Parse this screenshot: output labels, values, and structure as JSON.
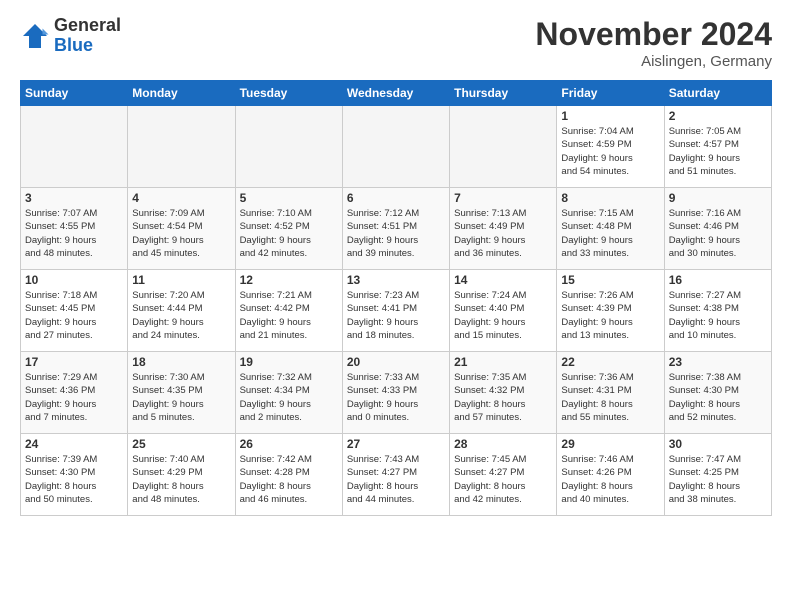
{
  "logo": {
    "general": "General",
    "blue": "Blue"
  },
  "title": "November 2024",
  "location": "Aislingen, Germany",
  "days_of_week": [
    "Sunday",
    "Monday",
    "Tuesday",
    "Wednesday",
    "Thursday",
    "Friday",
    "Saturday"
  ],
  "weeks": [
    [
      {
        "day": "",
        "info": ""
      },
      {
        "day": "",
        "info": ""
      },
      {
        "day": "",
        "info": ""
      },
      {
        "day": "",
        "info": ""
      },
      {
        "day": "",
        "info": ""
      },
      {
        "day": "1",
        "info": "Sunrise: 7:04 AM\nSunset: 4:59 PM\nDaylight: 9 hours\nand 54 minutes."
      },
      {
        "day": "2",
        "info": "Sunrise: 7:05 AM\nSunset: 4:57 PM\nDaylight: 9 hours\nand 51 minutes."
      }
    ],
    [
      {
        "day": "3",
        "info": "Sunrise: 7:07 AM\nSunset: 4:55 PM\nDaylight: 9 hours\nand 48 minutes."
      },
      {
        "day": "4",
        "info": "Sunrise: 7:09 AM\nSunset: 4:54 PM\nDaylight: 9 hours\nand 45 minutes."
      },
      {
        "day": "5",
        "info": "Sunrise: 7:10 AM\nSunset: 4:52 PM\nDaylight: 9 hours\nand 42 minutes."
      },
      {
        "day": "6",
        "info": "Sunrise: 7:12 AM\nSunset: 4:51 PM\nDaylight: 9 hours\nand 39 minutes."
      },
      {
        "day": "7",
        "info": "Sunrise: 7:13 AM\nSunset: 4:49 PM\nDaylight: 9 hours\nand 36 minutes."
      },
      {
        "day": "8",
        "info": "Sunrise: 7:15 AM\nSunset: 4:48 PM\nDaylight: 9 hours\nand 33 minutes."
      },
      {
        "day": "9",
        "info": "Sunrise: 7:16 AM\nSunset: 4:46 PM\nDaylight: 9 hours\nand 30 minutes."
      }
    ],
    [
      {
        "day": "10",
        "info": "Sunrise: 7:18 AM\nSunset: 4:45 PM\nDaylight: 9 hours\nand 27 minutes."
      },
      {
        "day": "11",
        "info": "Sunrise: 7:20 AM\nSunset: 4:44 PM\nDaylight: 9 hours\nand 24 minutes."
      },
      {
        "day": "12",
        "info": "Sunrise: 7:21 AM\nSunset: 4:42 PM\nDaylight: 9 hours\nand 21 minutes."
      },
      {
        "day": "13",
        "info": "Sunrise: 7:23 AM\nSunset: 4:41 PM\nDaylight: 9 hours\nand 18 minutes."
      },
      {
        "day": "14",
        "info": "Sunrise: 7:24 AM\nSunset: 4:40 PM\nDaylight: 9 hours\nand 15 minutes."
      },
      {
        "day": "15",
        "info": "Sunrise: 7:26 AM\nSunset: 4:39 PM\nDaylight: 9 hours\nand 13 minutes."
      },
      {
        "day": "16",
        "info": "Sunrise: 7:27 AM\nSunset: 4:38 PM\nDaylight: 9 hours\nand 10 minutes."
      }
    ],
    [
      {
        "day": "17",
        "info": "Sunrise: 7:29 AM\nSunset: 4:36 PM\nDaylight: 9 hours\nand 7 minutes."
      },
      {
        "day": "18",
        "info": "Sunrise: 7:30 AM\nSunset: 4:35 PM\nDaylight: 9 hours\nand 5 minutes."
      },
      {
        "day": "19",
        "info": "Sunrise: 7:32 AM\nSunset: 4:34 PM\nDaylight: 9 hours\nand 2 minutes."
      },
      {
        "day": "20",
        "info": "Sunrise: 7:33 AM\nSunset: 4:33 PM\nDaylight: 9 hours\nand 0 minutes."
      },
      {
        "day": "21",
        "info": "Sunrise: 7:35 AM\nSunset: 4:32 PM\nDaylight: 8 hours\nand 57 minutes."
      },
      {
        "day": "22",
        "info": "Sunrise: 7:36 AM\nSunset: 4:31 PM\nDaylight: 8 hours\nand 55 minutes."
      },
      {
        "day": "23",
        "info": "Sunrise: 7:38 AM\nSunset: 4:30 PM\nDaylight: 8 hours\nand 52 minutes."
      }
    ],
    [
      {
        "day": "24",
        "info": "Sunrise: 7:39 AM\nSunset: 4:30 PM\nDaylight: 8 hours\nand 50 minutes."
      },
      {
        "day": "25",
        "info": "Sunrise: 7:40 AM\nSunset: 4:29 PM\nDaylight: 8 hours\nand 48 minutes."
      },
      {
        "day": "26",
        "info": "Sunrise: 7:42 AM\nSunset: 4:28 PM\nDaylight: 8 hours\nand 46 minutes."
      },
      {
        "day": "27",
        "info": "Sunrise: 7:43 AM\nSunset: 4:27 PM\nDaylight: 8 hours\nand 44 minutes."
      },
      {
        "day": "28",
        "info": "Sunrise: 7:45 AM\nSunset: 4:27 PM\nDaylight: 8 hours\nand 42 minutes."
      },
      {
        "day": "29",
        "info": "Sunrise: 7:46 AM\nSunset: 4:26 PM\nDaylight: 8 hours\nand 40 minutes."
      },
      {
        "day": "30",
        "info": "Sunrise: 7:47 AM\nSunset: 4:25 PM\nDaylight: 8 hours\nand 38 minutes."
      }
    ]
  ]
}
